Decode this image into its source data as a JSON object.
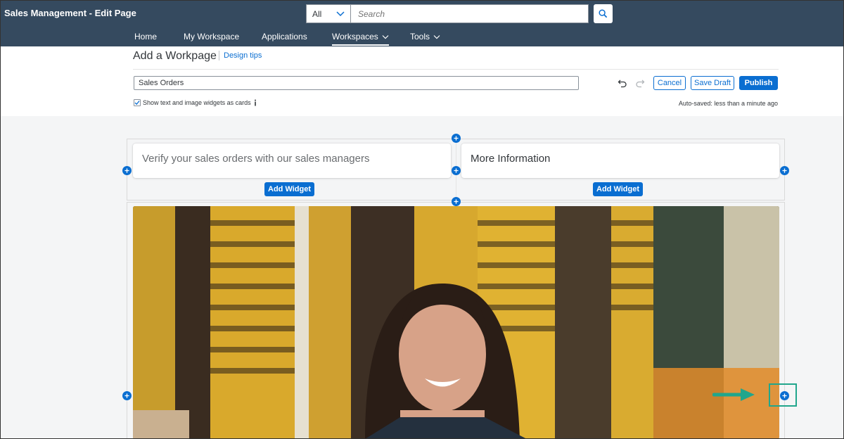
{
  "shell": {
    "title": "Sales Management - Edit Page",
    "search_scope": "All",
    "search_placeholder": "Search",
    "nav": [
      {
        "label": "Home"
      },
      {
        "label": "My Workspace"
      },
      {
        "label": "Applications"
      },
      {
        "label": "Workspaces",
        "active": true
      },
      {
        "label": "Tools"
      }
    ]
  },
  "editor": {
    "heading": "Add a Workpage",
    "design_tips": "Design tips",
    "page_name": "Sales Orders",
    "cancel": "Cancel",
    "save_draft": "Save Draft",
    "publish": "Publish",
    "checkbox_label": "Show text and image widgets as cards",
    "checkbox_checked": true,
    "autosave": "Auto-saved: less than a minute ago"
  },
  "canvas": {
    "card_left_text": "Verify your sales orders with our sales managers",
    "card_right_text": "More Information",
    "add_widget": "Add Widget"
  },
  "colors": {
    "shell_bg": "#354a5f",
    "accent": "#0a6ed1",
    "highlight": "#21a68c"
  }
}
